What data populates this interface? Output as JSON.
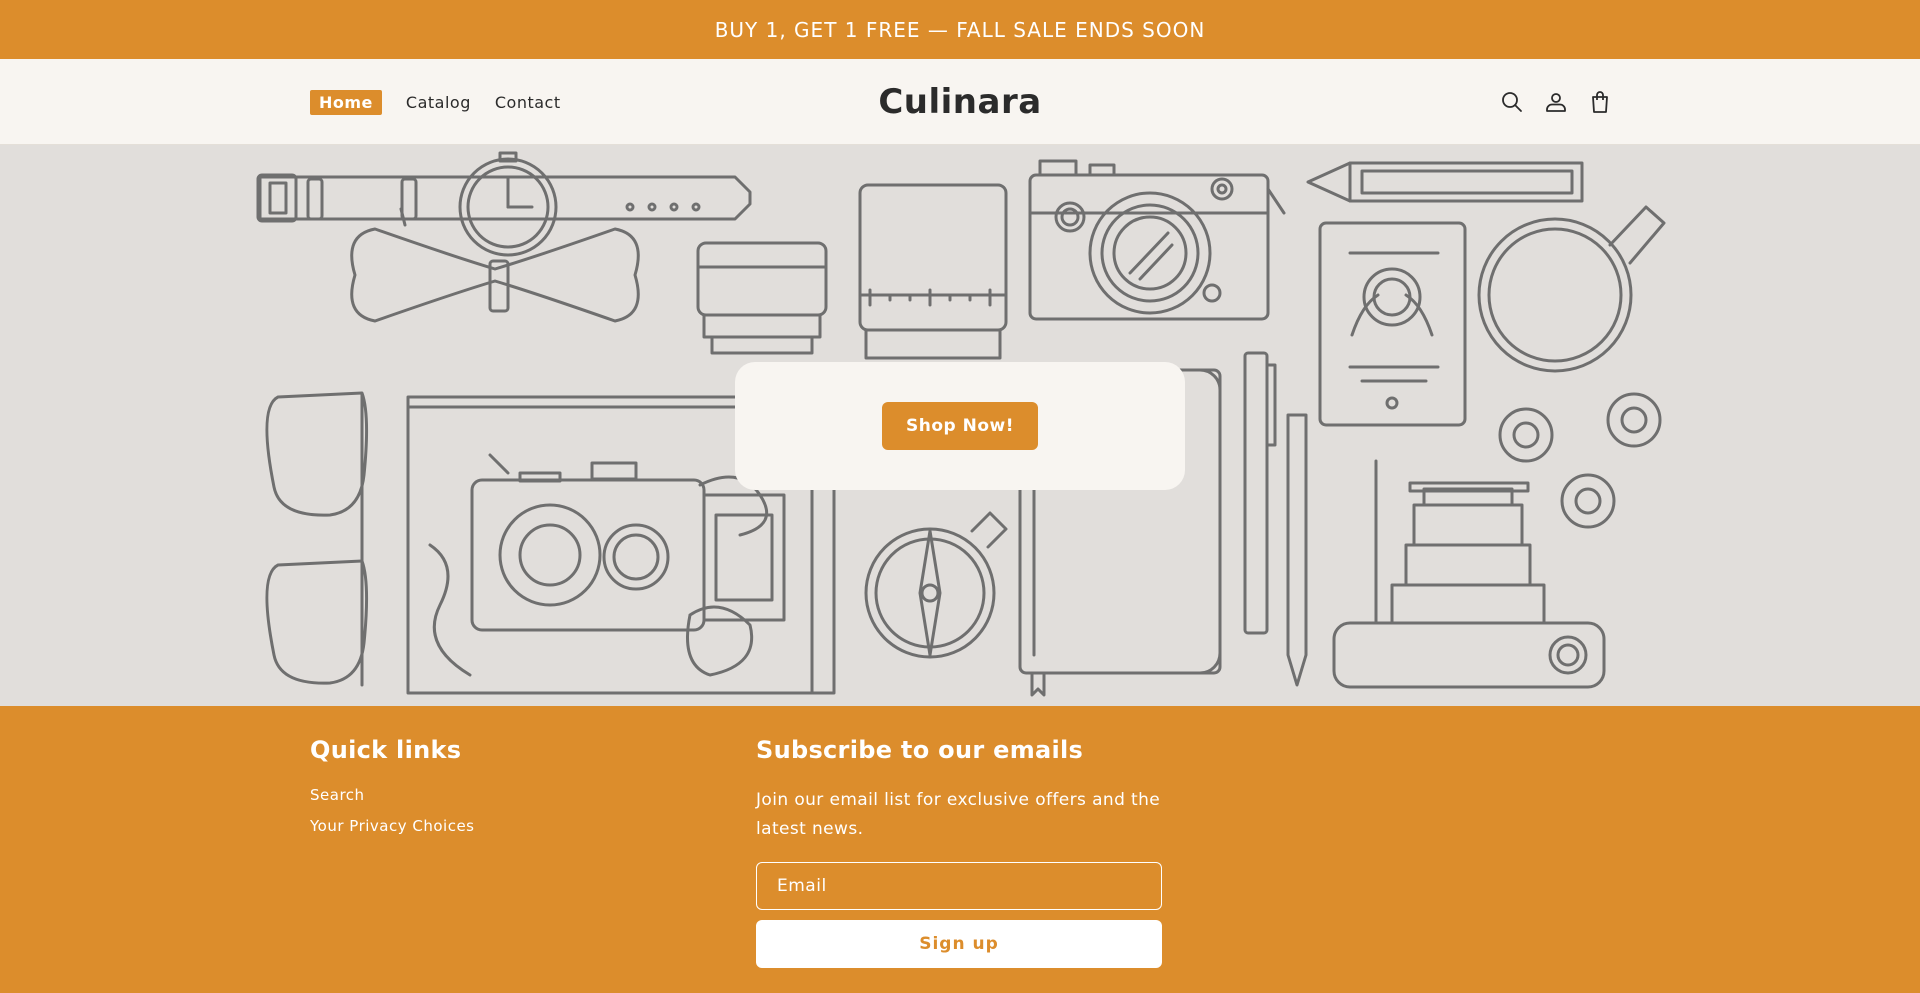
{
  "announcement": {
    "text": "BUY 1, GET 1 FREE — FALL SALE ENDS SOON"
  },
  "header": {
    "nav": [
      {
        "label": "Home",
        "active": true
      },
      {
        "label": "Catalog",
        "active": false
      },
      {
        "label": "Contact",
        "active": false
      }
    ],
    "logo": "Culinara",
    "icons": [
      "search-icon",
      "account-icon",
      "cart-icon"
    ]
  },
  "hero": {
    "button_label": "Shop Now!"
  },
  "footer": {
    "quick_links_heading": "Quick links",
    "links": [
      "Search",
      "Your Privacy Choices"
    ],
    "subscribe_heading": "Subscribe to our emails",
    "subscribe_text": "Join our email list for exclusive offers and the latest news.",
    "email_placeholder": "Email",
    "signup_label": "Sign up"
  },
  "colors": {
    "accent": "#dc8d2c",
    "background": "#f8f5f1",
    "hero_bg": "#e1dedb",
    "line_art": "#6f6f6f"
  }
}
